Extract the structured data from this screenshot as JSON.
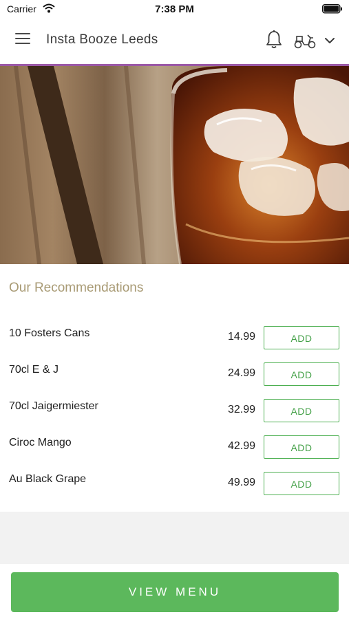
{
  "status_bar": {
    "carrier": "Carrier",
    "time": "7:38 PM"
  },
  "header": {
    "title": "Insta Booze Leeds",
    "icons": [
      "menu-icon",
      "bell-icon",
      "scooter-icon",
      "chevron-down-icon"
    ],
    "accent_color": "#9b59a6"
  },
  "hero": {
    "image": "whisky-glass-with-ice-on-wood"
  },
  "recommendations": {
    "title": "Our Recommendations",
    "items": [
      {
        "name": "10 Fosters Cans",
        "price": "14.99",
        "button": "ADD"
      },
      {
        "name": "70cl E & J",
        "price": "24.99",
        "button": "ADD"
      },
      {
        "name": "70cl Jaigermiester",
        "price": "32.99",
        "button": "ADD"
      },
      {
        "name": "Ciroc Mango",
        "price": "42.99",
        "button": "ADD"
      },
      {
        "name": "Au Black Grape",
        "price": "49.99",
        "button": "ADD"
      }
    ]
  },
  "footer": {
    "button_label": "VIEW MENU",
    "button_color": "#5cb85c"
  }
}
